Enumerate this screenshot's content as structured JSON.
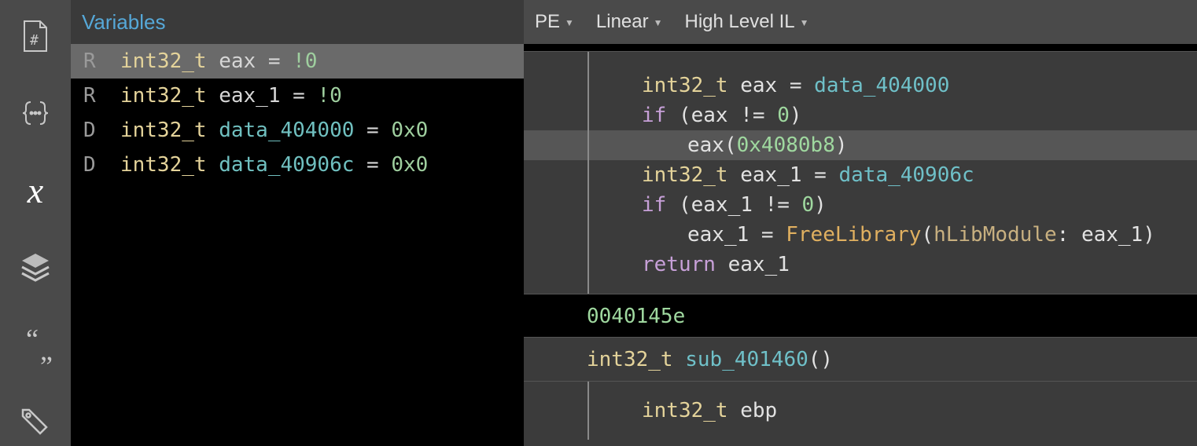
{
  "sidebar": {
    "icons": [
      "hash-file-icon",
      "braces-icon",
      "x-variable-icon",
      "layers-icon",
      "quotes-icon",
      "tag-icon"
    ]
  },
  "variables": {
    "title": "Variables",
    "rows": [
      {
        "kind": "R",
        "type": "int32_t",
        "name": "eax",
        "nameclass": "ident",
        "eq": " = ",
        "value": "!0",
        "selected": true
      },
      {
        "kind": "R",
        "type": "int32_t",
        "name": "eax_1",
        "nameclass": "ident",
        "eq": " = ",
        "value": "!0",
        "selected": false
      },
      {
        "kind": "D",
        "type": "int32_t",
        "name": "data_404000",
        "nameclass": "ident dataref",
        "eq": " = ",
        "value": "0x0",
        "selected": false
      },
      {
        "kind": "D",
        "type": "int32_t",
        "name": "data_40906c",
        "nameclass": "ident dataref",
        "eq": " = ",
        "value": "0x0",
        "selected": false
      }
    ]
  },
  "topbar": {
    "drops": [
      "PE",
      "Linear",
      "High Level IL"
    ]
  },
  "code": {
    "func1": {
      "l1": {
        "type": "int32_t ",
        "id": "eax",
        "mid": " = ",
        "data": "data_404000"
      },
      "l2": {
        "kw": "if ",
        "rest": "(eax != ",
        "num": "0",
        "close": ")"
      },
      "l3": {
        "pre": "eax(",
        "num": "0x4080b8",
        "post": ")"
      },
      "l4": {
        "type": "int32_t ",
        "id": "eax_1",
        "mid": " = ",
        "data": "data_40906c"
      },
      "l5": {
        "kw": "if ",
        "rest": "(eax_1 != ",
        "num": "0",
        "close": ")"
      },
      "l6": {
        "lhs": "eax_1 = ",
        "fn": "FreeLibrary",
        "open": "(",
        "arg": "hLibModule",
        "colon": ": ",
        "argv": "eax_1",
        "close": ")"
      },
      "l7": {
        "kw": "return ",
        "id": "eax_1"
      }
    },
    "addr": "0040145e",
    "proto": {
      "type": "int32_t ",
      "name": "sub_401460",
      "paren": "()"
    },
    "func2": {
      "l1": {
        "type": "int32_t ",
        "id": "ebp"
      }
    }
  }
}
